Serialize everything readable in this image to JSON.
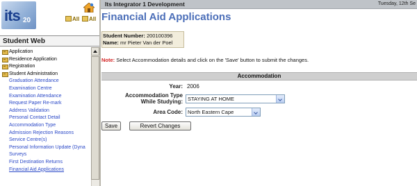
{
  "logo": {
    "text": "its",
    "number": "20"
  },
  "toolbar": {
    "all_label_1": "All",
    "all_label_2": "All"
  },
  "nav": {
    "header": "Student Web",
    "items": [
      {
        "label": "Application",
        "level": "top"
      },
      {
        "label": "Residence Application",
        "level": "top"
      },
      {
        "label": "Registration",
        "level": "top"
      },
      {
        "label": "Student Administration",
        "level": "top"
      },
      {
        "label": "Graduation Attendance",
        "level": "sub"
      },
      {
        "label": "Examination Centre",
        "level": "sub"
      },
      {
        "label": "Examination Attendance",
        "level": "sub"
      },
      {
        "label": "Request Paper Re-mark",
        "level": "sub"
      },
      {
        "label": "Address Validation",
        "level": "sub"
      },
      {
        "label": "Personal Contact Detail",
        "level": "sub"
      },
      {
        "label": "Accommodation Type",
        "level": "sub"
      },
      {
        "label": "Admission Rejection Reasons",
        "level": "sub"
      },
      {
        "label": "Service Centre(s)",
        "level": "sub"
      },
      {
        "label": "Personal Information Update (Dyna",
        "level": "sub"
      },
      {
        "label": "Surveys",
        "level": "sub"
      },
      {
        "label": "First Destination Returns",
        "level": "sub"
      },
      {
        "label": "Financial Aid Applications",
        "level": "sub",
        "current": true
      }
    ]
  },
  "header": {
    "app_title": "Its Integrator 1 Development",
    "date": "Tuesday, 12th Se"
  },
  "main": {
    "page_title": "Financial Aid Applications",
    "student": {
      "number_label": "Student Number:",
      "number": "200100396",
      "name_label": "Name:",
      "name": "mr Pieter Van der Poel"
    },
    "note_label": "Note:",
    "note_text": "Select Accommodation details and click on the 'Save' button to submit the changes.",
    "section_title": "Accommodation",
    "year_label": "Year:",
    "year_value": "2006",
    "accommodation_label_line1": "Accommodation Type",
    "accommodation_label_line2": "While Studying:",
    "accommodation_value": "STAYING AT HOME",
    "area_label": "Area Code:",
    "area_value": "North Eastern Cape",
    "save_label": "Save",
    "revert_label": "Revert Changes"
  },
  "colors": {
    "title_blue": "#4b6eb8",
    "nav_link_blue": "#2a48c7",
    "note_red": "#d22020",
    "student_box_bg": "#f2eddc",
    "topbar_gray": "#bfc3c8"
  },
  "icons": [
    "home-icon",
    "folder-icon",
    "scroll-up-arrow-icon",
    "dropdown-arrow-icon"
  ]
}
